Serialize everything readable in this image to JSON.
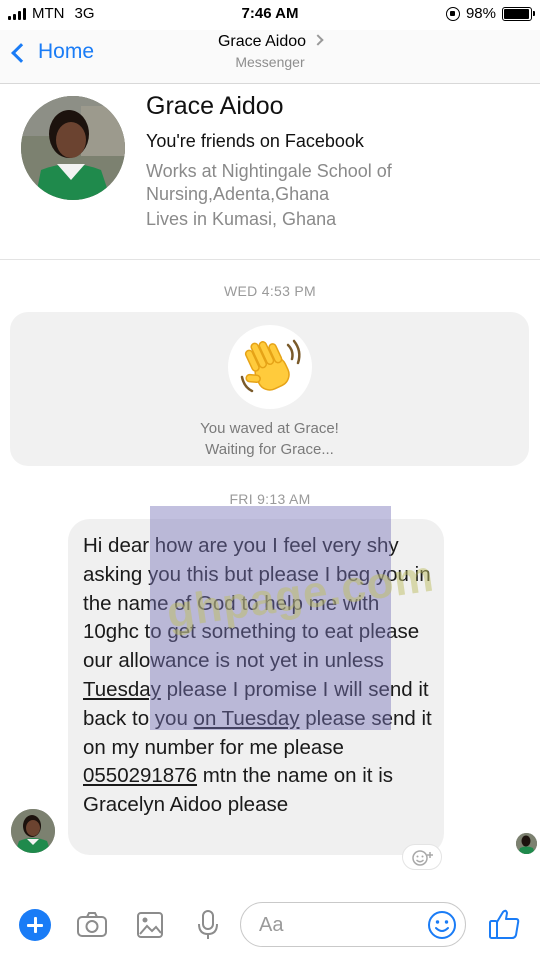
{
  "status_bar": {
    "carrier": "MTN",
    "network": "3G",
    "time": "7:46 AM",
    "battery": "98%",
    "battery_level": 0.98
  },
  "nav": {
    "back_label": "Home",
    "title": "Grace Aidoo",
    "subtitle": "Messenger"
  },
  "profile": {
    "name": "Grace Aidoo",
    "friends": "You're friends on Facebook",
    "work": "Works at Nightingale School of Nursing,Adenta,Ghana",
    "lives": "Lives in Kumasi, Ghana"
  },
  "wave": {
    "timestamp": "WED 4:53 PM",
    "line1": "You waved at Grace!",
    "line2": "Waiting for Grace..."
  },
  "message": {
    "timestamp": "FRI 9:13 AM",
    "parts": {
      "p1": "Hi dear how are you I feel very shy asking you this but please I beg you in the name of God to help me with 10ghc to get something to eat please our allowance is not yet in unless ",
      "link1": "Tuesday",
      "p2": " please I promise I will send it back to you ",
      "link2": "on Tuesday",
      "p3": " please send it on my number for me please ",
      "phone": "0550291876",
      "p4": " mtn the name on it is Gracelyn Aidoo please"
    }
  },
  "watermark": "ghpage.com",
  "composer": {
    "placeholder": "Aa"
  },
  "colors": {
    "accent": "#1a7cf6",
    "bubble": "#f0f0f0"
  },
  "icons": [
    "signal-icon",
    "lock-rotation-icon",
    "battery-icon",
    "back-chevron-icon",
    "wave-emoji-icon",
    "add-reaction-icon",
    "plus-icon",
    "camera-icon",
    "image-icon",
    "microphone-icon",
    "emoji-icon",
    "thumbs-up-icon"
  ]
}
